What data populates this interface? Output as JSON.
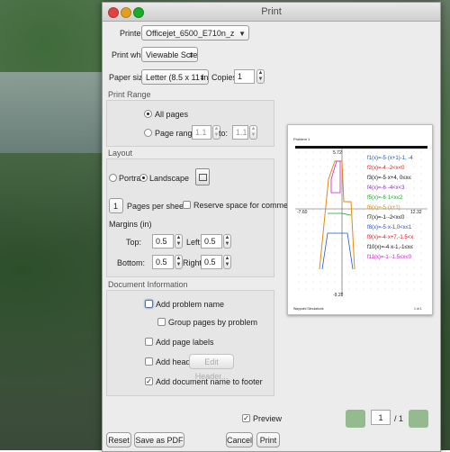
{
  "window": {
    "title": "Print"
  },
  "printer": {
    "label": "Printer:",
    "value": "Officejet_6500_E710n_z"
  },
  "print_what": {
    "label": "Print what:",
    "value": "Viewable Screen"
  },
  "paper_size": {
    "label": "Paper size:",
    "value": "Letter (8.5 x 11 in)"
  },
  "copies": {
    "label": "Copies:",
    "value": "1"
  },
  "print_range": {
    "title": "Print Range",
    "all_pages": "All pages",
    "page_range": "Page range:",
    "from_value": "1.1",
    "to_label": "to:",
    "to_value": "1.1"
  },
  "layout": {
    "title": "Layout",
    "portrait": "Portrait",
    "landscape": "Landscape",
    "pages_per_sheet_value": "1",
    "pages_per_sheet_label": "Pages per sheet",
    "reserve_space": "Reserve space for comments",
    "margins_label": "Margins (in)",
    "top_label": "Top:",
    "top_value": "0.5",
    "left_label": "Left:",
    "left_value": "0.5",
    "bottom_label": "Bottom:",
    "bottom_value": "0.5",
    "right_label": "Right:",
    "right_value": "0.5"
  },
  "doc_info": {
    "title": "Document Information",
    "add_problem_name": "Add problem name",
    "group_pages": "Group pages by problem",
    "add_page_labels": "Add page labels",
    "add_header": "Add header",
    "edit_header": "Edit Header...",
    "add_doc_name": "Add document name to footer"
  },
  "preview_toggle": {
    "label": "Preview",
    "checked": true
  },
  "preview": {
    "problem": "Problem 1",
    "y_top": "5.72",
    "x_left": "-7.60",
    "x_right": "12.32",
    "y_bottom": "-9.28",
    "footer_left": "Waypoint Simulations",
    "footer_right": "1 of 1",
    "functions": [
      {
        "text": "f1(x)=-5·(x+1)-1, -4",
        "color": "#1a55c8"
      },
      {
        "text": "f2(x)=-4·-2<x<0",
        "color": "#d21c1c"
      },
      {
        "text": "f3(x)=-5·x+4, 0≤x≤",
        "color": "#111111"
      },
      {
        "text": "f4(x)=-6·-4<x<3",
        "color": "#8a2bd0"
      },
      {
        "text": "f5(x)=-6·1<x≤2",
        "color": "#1aa02a"
      },
      {
        "text": "f6(x)=-5·(x+1)",
        "color": "#e38b12"
      },
      {
        "text": "f7(x)=-1·-2<x≤0",
        "color": "#111111"
      },
      {
        "text": "f8(x)=-5·x-1,0<x≤1",
        "color": "#1a55c8"
      },
      {
        "text": "f9(x)=-4·x+7,-1.5<x",
        "color": "#d21c1c"
      },
      {
        "text": "f10(x)=-4·x-1,-1≤x≤",
        "color": "#111111"
      },
      {
        "text": "f11(x)=-1·-1.5≤x≤0",
        "color": "#c81ec8"
      }
    ]
  },
  "pagination": {
    "current": "1",
    "total": "/ 1"
  },
  "buttons": {
    "reset": "Reset",
    "save_pdf": "Save as PDF",
    "cancel": "Cancel",
    "print": "Print"
  }
}
